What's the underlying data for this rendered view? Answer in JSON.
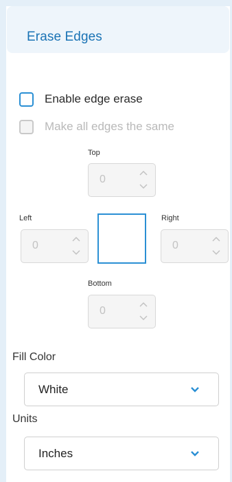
{
  "header": {
    "title": "Erase Edges"
  },
  "options": {
    "enable_edge_erase": {
      "label": "Enable edge erase",
      "checked": false
    },
    "make_all_same": {
      "label": "Make all edges the same",
      "checked": false,
      "disabled": true
    }
  },
  "edges": {
    "top": {
      "label": "Top",
      "value": "0"
    },
    "left": {
      "label": "Left",
      "value": "0"
    },
    "right": {
      "label": "Right",
      "value": "0"
    },
    "bottom": {
      "label": "Bottom",
      "value": "0"
    }
  },
  "fill_color": {
    "label": "Fill Color",
    "value": "White"
  },
  "units": {
    "label": "Units",
    "value": "Inches"
  },
  "colors": {
    "accent": "#2a8fd4",
    "title": "#1a73b5",
    "disabled": "#c2c2c2"
  }
}
